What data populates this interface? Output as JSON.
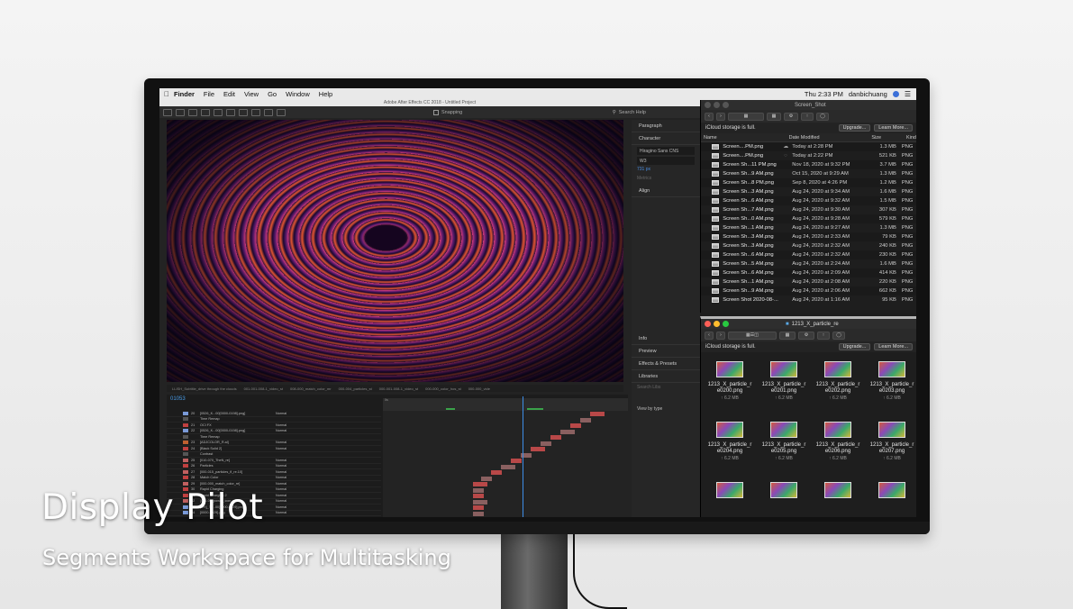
{
  "menubar": {
    "app": "Finder",
    "items": [
      "File",
      "Edit",
      "View",
      "Go",
      "Window",
      "Help"
    ],
    "clock": "Thu 2:33 PM",
    "user": "danbichuang"
  },
  "after_effects": {
    "window_title": "Adobe After Effects CC 2018 - Untitled Project",
    "snapping_label": "Snapping",
    "search_help": "Search Help",
    "timecode": "01053",
    "viewer_tabs": [
      "LLISH_Subtitle_drive through the clouds",
      "001-001-008-1_video_st",
      "008-000_match_color_mr",
      "000-004_particles_st",
      "000-001-008-1_video_st",
      "000-000_color_hos_st",
      "000-000_vide"
    ],
    "right_panels": {
      "paragraph": "Paragraph",
      "character": "Character",
      "font": "Hiragino Sans CNS",
      "weight": "W3",
      "font_size": "731 px",
      "tracking": "Metrics",
      "align": "Align",
      "info": "Info",
      "preview": "Preview",
      "effects": "Effects & Presets",
      "libraries": "Libraries",
      "search_libs": "Search Libs",
      "view_by": "View by type"
    },
    "layers": [
      {
        "num": "20",
        "name": "[0526_K...00[0000-0198].png]",
        "mode": "Normal",
        "color": "#7a9ad8"
      },
      {
        "num": "",
        "name": "Time Remap",
        "mode": "",
        "color": "#555555"
      },
      {
        "num": "21",
        "name": "OCI FX",
        "mode": "Normal",
        "color": "#c04040"
      },
      {
        "num": "22",
        "name": "[0526_K...00[0000-0198].png]",
        "mode": "Normal",
        "color": "#7a9ad8"
      },
      {
        "num": "",
        "name": "Time Remap",
        "mode": "",
        "color": "#555555"
      },
      {
        "num": "23",
        "name": "[ADJCOLOR_R.ai]",
        "mode": "Normal",
        "color": "#c06030"
      },
      {
        "num": "24",
        "name": "[Black Solid 2]",
        "mode": "Normal",
        "color": "#c04040"
      },
      {
        "num": "",
        "name": "Contrast",
        "mode": "",
        "color": "#555555"
      },
      {
        "num": "25",
        "name": "[010-070_TheN_re]",
        "mode": "Normal",
        "color": "#c06060"
      },
      {
        "num": "26",
        "name": "Particles",
        "mode": "Normal",
        "color": "#c04040"
      },
      {
        "num": "27",
        "name": "[000-015_particles_fl_re.10]",
        "mode": "Normal",
        "color": "#c06060"
      },
      {
        "num": "28",
        "name": "Match Color",
        "mode": "Normal",
        "color": "#c04040"
      },
      {
        "num": "29",
        "name": "[000-000_match_color_re]",
        "mode": "Normal",
        "color": "#c06060"
      },
      {
        "num": "30",
        "name": "Rapid Charging",
        "mode": "Normal",
        "color": "#c04040"
      },
      {
        "num": "31",
        "name": "Rapid Charging 2",
        "mode": "Normal",
        "color": "#c04040"
      },
      {
        "num": "32",
        "name": "[001-00_power_icon_re.10]",
        "mode": "Normal",
        "color": "#c06060"
      },
      {
        "num": "33",
        "name": "[CH]_Tit...00[0000-0029].png]",
        "mode": "Normal",
        "color": "#7a9ad8"
      },
      {
        "num": "34",
        "name": "[0000-0029].png",
        "mode": "Normal",
        "color": "#7a9ad8"
      }
    ]
  },
  "finder_top": {
    "title": "Screen_Shot",
    "storage_msg": "iCloud storage is full.",
    "upgrade_btn": "Upgrade...",
    "learn_btn": "Learn More...",
    "columns": {
      "name": "Name",
      "date": "Date Modified",
      "size": "Size",
      "kind": "Kind"
    },
    "files": [
      {
        "name": "Screen....PM.png",
        "cloud": "☁",
        "date": "Today at 2:28 PM",
        "size": "1.3 MB",
        "kind": "PNG"
      },
      {
        "name": "Screen....PM.png",
        "cloud": "◌",
        "date": "Today at 2:22 PM",
        "size": "521 KB",
        "kind": "PNG"
      },
      {
        "name": "Screen Sh...11 PM.png",
        "cloud": "",
        "date": "Nov 18, 2020 at 9:32 PM",
        "size": "3.7 MB",
        "kind": "PNG"
      },
      {
        "name": "Screen Sh...9 AM.png",
        "cloud": "",
        "date": "Oct 15, 2020 at 9:29 AM",
        "size": "1.3 MB",
        "kind": "PNG"
      },
      {
        "name": "Screen Sh...8 PM.png",
        "cloud": "",
        "date": "Sep 8, 2020 at 4:26 PM",
        "size": "1.2 MB",
        "kind": "PNG"
      },
      {
        "name": "Screen Sh...3 AM.png",
        "cloud": "",
        "date": "Aug 24, 2020 at 9:34 AM",
        "size": "1.6 MB",
        "kind": "PNG"
      },
      {
        "name": "Screen Sh...6 AM.png",
        "cloud": "",
        "date": "Aug 24, 2020 at 9:32 AM",
        "size": "1.5 MB",
        "kind": "PNG"
      },
      {
        "name": "Screen Sh...7 AM.png",
        "cloud": "",
        "date": "Aug 24, 2020 at 9:30 AM",
        "size": "307 KB",
        "kind": "PNG"
      },
      {
        "name": "Screen Sh...0 AM.png",
        "cloud": "",
        "date": "Aug 24, 2020 at 9:28 AM",
        "size": "579 KB",
        "kind": "PNG"
      },
      {
        "name": "Screen Sh...1 AM.png",
        "cloud": "",
        "date": "Aug 24, 2020 at 9:27 AM",
        "size": "1.3 MB",
        "kind": "PNG"
      },
      {
        "name": "Screen Sh...3 AM.png",
        "cloud": "",
        "date": "Aug 24, 2020 at 2:33 AM",
        "size": "79 KB",
        "kind": "PNG"
      },
      {
        "name": "Screen Sh...3 AM.png",
        "cloud": "",
        "date": "Aug 24, 2020 at 2:32 AM",
        "size": "240 KB",
        "kind": "PNG"
      },
      {
        "name": "Screen Sh...6 AM.png",
        "cloud": "",
        "date": "Aug 24, 2020 at 2:32 AM",
        "size": "230 KB",
        "kind": "PNG"
      },
      {
        "name": "Screen Sh...5 AM.png",
        "cloud": "",
        "date": "Aug 24, 2020 at 2:24 AM",
        "size": "1.6 MB",
        "kind": "PNG"
      },
      {
        "name": "Screen Sh...6 AM.png",
        "cloud": "",
        "date": "Aug 24, 2020 at 2:09 AM",
        "size": "414 KB",
        "kind": "PNG"
      },
      {
        "name": "Screen Sh...1 AM.png",
        "cloud": "",
        "date": "Aug 24, 2020 at 2:08 AM",
        "size": "220 KB",
        "kind": "PNG"
      },
      {
        "name": "Screen Sh...9 AM.png",
        "cloud": "",
        "date": "Aug 24, 2020 at 2:06 AM",
        "size": "662 KB",
        "kind": "PNG"
      },
      {
        "name": "Screen Shot 2020-08-...",
        "cloud": "",
        "date": "Aug 24, 2020 at 1:16 AM",
        "size": "95 KB",
        "kind": "PNG"
      }
    ]
  },
  "finder_bottom": {
    "title": "1213_X_particle_re",
    "storage_msg": "iCloud storage is full.",
    "upgrade_btn": "Upgrade...",
    "learn_btn": "Learn More...",
    "items": [
      {
        "name": "1213_X_particle_r e0200.png",
        "size": "↑ 6.2 MB"
      },
      {
        "name": "1213_X_particle_r e0201.png",
        "size": "↑ 6.2 MB"
      },
      {
        "name": "1213_X_particle_r e0202.png",
        "size": "↑ 6.2 MB"
      },
      {
        "name": "1213_X_particle_r e0203.png",
        "size": "↑ 6.2 MB"
      },
      {
        "name": "1213_X_particle_r e0204.png",
        "size": "↑ 6.2 MB"
      },
      {
        "name": "1213_X_particle_r e0205.png",
        "size": "↑ 6.2 MB"
      },
      {
        "name": "1213_X_particle_r e0206.png",
        "size": "↑ 6.2 MB"
      },
      {
        "name": "1213_X_particle_r e0207.png",
        "size": "↑ 6.2 MB"
      },
      {
        "name": "",
        "size": ""
      },
      {
        "name": "",
        "size": ""
      },
      {
        "name": "",
        "size": ""
      },
      {
        "name": "",
        "size": ""
      }
    ]
  },
  "caption": {
    "title": "Display Pilot",
    "subtitle": "Segments Workspace for Multitasking"
  },
  "colors": {
    "traffic_red": "#ff5f57",
    "traffic_yellow": "#febc2e",
    "traffic_green": "#28c840",
    "ae_blue": "#3d8ee8"
  }
}
